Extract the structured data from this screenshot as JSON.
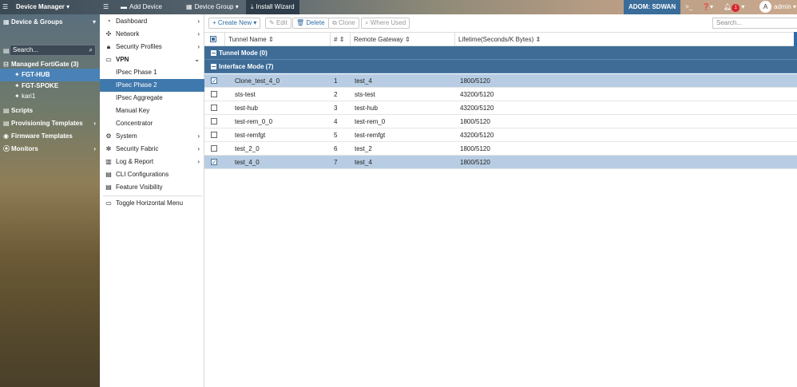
{
  "topbar": {
    "app_title": "Device Manager",
    "add_device": "Add Device",
    "device_group": "Device Group",
    "install_wizard": "Install Wizard",
    "adom": "ADOM: SDWAN",
    "notif_count": "1",
    "user_initial": "A",
    "user": "admin"
  },
  "leftpanel": {
    "device_groups": "Device & Groups",
    "search_placeholder": "Search...",
    "managed": "Managed FortiGate (3)",
    "devices": [
      "FGT-HUB",
      "FGT-SPOKE",
      "kari1"
    ],
    "scripts": "Scripts",
    "provisioning": "Provisioning Templates",
    "firmware": "Firmware Templates",
    "monitors": "Monitors"
  },
  "nav": {
    "dashboard": "Dashboard",
    "network": "Network",
    "security_profiles": "Security Profiles",
    "vpn": "VPN",
    "ipsec_phase1": "IPsec Phase 1",
    "ipsec_phase2": "IPsec Phase 2",
    "ipsec_aggregate": "IPsec Aggregate",
    "manual_key": "Manual Key",
    "concentrator": "Concentrator",
    "system": "System",
    "security_fabric": "Security Fabric",
    "log_report": "Log & Report",
    "cli_configs": "CLI Configurations",
    "feature_visibility": "Feature Visibility",
    "toggle_menu": "Toggle Horizontal Menu"
  },
  "toolbar": {
    "create_new": "Create New",
    "edit": "Edit",
    "delete": "Delete",
    "clone": "Clone",
    "where_used": "Where Used",
    "search_placeholder": "Search..."
  },
  "table": {
    "columns": [
      "Tunnel Name",
      "#",
      "Remote Gateway",
      "Lifetime(Seconds/K Bytes)"
    ],
    "group_tunnel": "Tunnel Mode (0)",
    "group_interface": "Interface Mode (7)",
    "rows": [
      {
        "name": "Clone_test_4_0",
        "num": "1",
        "gateway": "test_4",
        "lifetime": "1800/5120",
        "selected": true
      },
      {
        "name": "sts-test",
        "num": "2",
        "gateway": "sts-test",
        "lifetime": "43200/5120",
        "selected": false
      },
      {
        "name": "test-hub",
        "num": "3",
        "gateway": "test-hub",
        "lifetime": "43200/5120",
        "selected": false
      },
      {
        "name": "test-rem_0_0",
        "num": "4",
        "gateway": "test-rem_0",
        "lifetime": "1800/5120",
        "selected": false
      },
      {
        "name": "test-remfgt",
        "num": "5",
        "gateway": "test-remfgt",
        "lifetime": "43200/5120",
        "selected": false
      },
      {
        "name": "test_2_0",
        "num": "6",
        "gateway": "test_2",
        "lifetime": "1800/5120",
        "selected": false
      },
      {
        "name": "test_4_0",
        "num": "7",
        "gateway": "test_4",
        "lifetime": "1800/5120",
        "selected": true
      }
    ]
  }
}
